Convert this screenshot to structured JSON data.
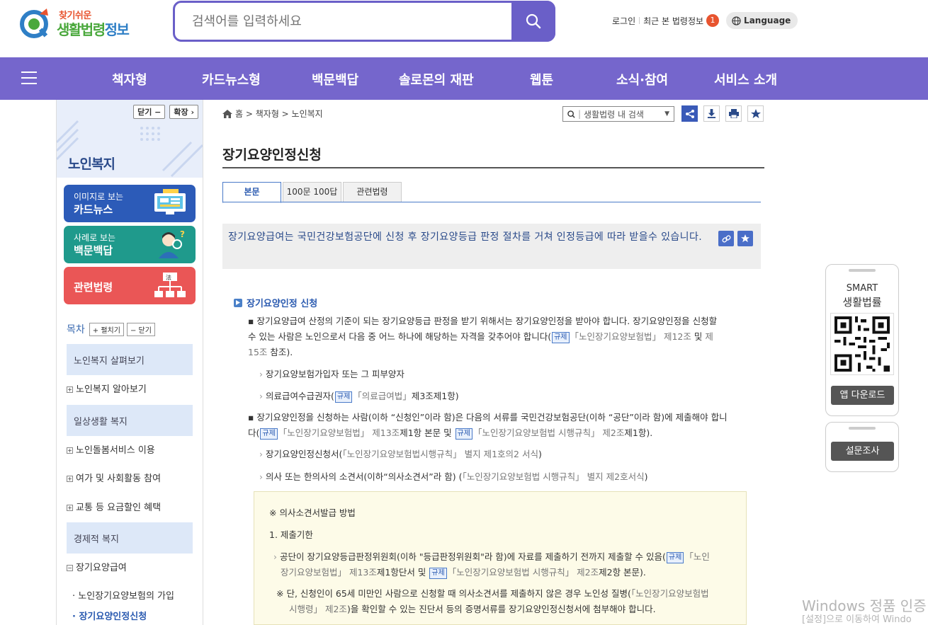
{
  "header": {
    "logo_small": "찾기쉬운",
    "logo_big_a": "생활법령",
    "logo_big_b": "정보",
    "search_placeholder": "검색어를 입력하세요",
    "login": "로그인",
    "recent": "최근 본 법령정보",
    "recent_count": "1",
    "language": "Language"
  },
  "nav": {
    "items": [
      "책자형",
      "카드뉴스형",
      "백문백답",
      "솔로몬의 재판",
      "웹툰",
      "소식·참여",
      "서비스 소개"
    ]
  },
  "sidebar": {
    "close_btn": "닫기 −",
    "expand_btn": "확장 ›",
    "title": "노인복지",
    "cards": [
      {
        "small": "이미지로 보는",
        "large": "카드뉴스",
        "color": "#2c5bb8"
      },
      {
        "small": "사례로 보는",
        "large": "백문백답",
        "color": "#1f9a8c"
      },
      {
        "small": "",
        "large": "관련법령",
        "color": "#ea5656"
      }
    ],
    "toc_label": "목차",
    "toc_expand": "+ 펼치기",
    "toc_close": "− 닫기",
    "sections": {
      "s1": "노인복지 살펴보기",
      "s1_items": [
        "노인복지 알아보기"
      ],
      "s2": "일상생활 복지",
      "s2_items": [
        "노인돌봄서비스 이용",
        "여가 및 사회활동 참여",
        "교통 등 요금할인 혜택"
      ],
      "s3": "경제적 복지",
      "s3_items": [
        "장기요양급여"
      ],
      "s3_sub": [
        "노인장기요양보험의 가입",
        "장기요양인정신청"
      ]
    }
  },
  "breadcrumb": {
    "home": "홈",
    "c1": "책자형",
    "c2": "노인복지"
  },
  "inner_search": "생활법령 내 검색",
  "page_title": "장기요양인정신청",
  "tabs": [
    "본문",
    "100문 100답",
    "관련법령"
  ],
  "summary": "장기요양급여는 국민건강보험공단에 신청 후 장기요양등급 판정 절차를 거쳐 인정등급에 따라 받을수 있습니다.",
  "content": {
    "heading": "장기요양인정 신청",
    "p1_a": "장기요양급여 산정의 기준이 되는 장기요양등급 판정을 받기 위해서는 장기요양인정을 받아야 합니다. 장기요양인정을 신청할",
    "p1_b": "수 있는 사람은 노인으로서 다음 중 어느 하나에 해당하는 자격을 갖추어야 합니다(",
    "p1_tag": "규제",
    "p1_law": "「노인장기요양보험법」 제12조",
    "p1_and": "및",
    "p1_law2a": "제",
    "p1_law2b": "15조",
    "p1_end": "참조).",
    "l1": "장기요양보험가입자 또는 그 피부양자",
    "l2_a": "의료급여수급권자(",
    "l2_law": "「의료급여법」",
    "l2_b": "제3조제1항)",
    "p2_a": "장기요양인정을 신청하는 사람(이하 “신청인”이라 함)은 다음의 서류를 국민건강보험공단(이하 “공단”이라 함)에 제출해야 합니",
    "p2_b": "다(",
    "p2_law1": "「노인장기요양보험법」 제13조",
    "p2_c": "제1항 본문 및",
    "p2_law2": "「노인장기요양보험법 시행규칙」 제2조",
    "p2_d": "제1항).",
    "l3_a": "장기요양인정신청서(",
    "l3_law": "「노인장기요양보험법시행규칙」 별지 제1호의2 서식",
    "l3_b": ")",
    "l4_a": "의사 또는 한의사의 소견서(이하“의사소견서”라 함) (",
    "l4_law": "「노인장기요양보험법 시행규칙」 별지 제2호서식",
    "l4_b": ")",
    "note_title": "※ 의사소견서발급 방법",
    "note_h": "1. 제출기한",
    "note_p1_a": "공단이 장기요양등급판정위원회(이하 \"등급판정위원회\"라 함)에 자료를 제출하기 전까지 제출할 수 있음(",
    "note_p1_law_a": "「노인",
    "note_p1_law_b": "장기요양보험법」 제13조",
    "note_p1_b": "제1항단서 및",
    "note_p1_law2": "「노인장기요양보험법 시행규칙」 제2조",
    "note_p1_c": "제2항 본문).",
    "note_p2_a": "※ 단, 신청인이 65세 미만인 사람으로 신청할 때 의사소견서를 제출하지 않은 경우 노인성 질병(",
    "note_p2_law_a": "「노인장기요양보험법",
    "note_p2_law_b": "시행령」 제2조",
    "note_p2_b": ")을 확인할 수 있는 진단서 등의 증명서류를 장기요양인정신청서에 첨부해야 합니다."
  },
  "right_panel": {
    "smart": "SMART",
    "smart_sub": "생활법률",
    "app_download": "앱 다운로드",
    "survey": "설문조사"
  },
  "watermark": {
    "line1": "Windows 정품 인증",
    "line2": "[설정]으로 이동하여 Windo"
  },
  "colors": {
    "nav": "#7566cc",
    "accent": "#2a5ab0",
    "badge": "#e8542f"
  }
}
